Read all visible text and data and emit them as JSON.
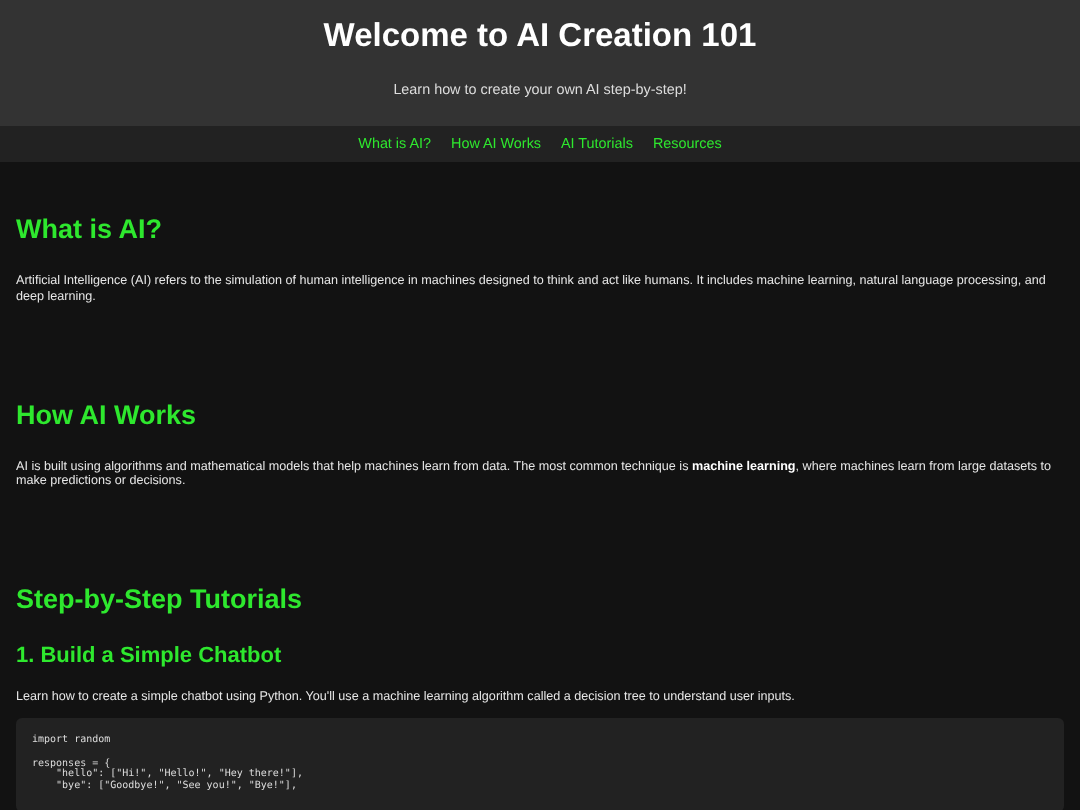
{
  "header": {
    "title": "Welcome to AI Creation 101",
    "subtitle": "Learn how to create your own AI step-by-step!"
  },
  "nav": [
    "What is AI?",
    "How AI Works",
    "AI Tutorials",
    "Resources"
  ],
  "sections": [
    {
      "heading": "What is AI?",
      "paragraph": "Artificial Intelligence (AI) refers to the simulation of human intelligence in machines designed to think and act like humans. It includes machine learning, natural language processing, and deep learning."
    },
    {
      "heading": "How AI Works",
      "paragraph": "AI is built using algorithms and mathematical models that help machines learn from data. The most common technique is **machine learning**, where machines learn from large datasets to make predictions or decisions."
    },
    {
      "heading": "Step-by-Step Tutorials",
      "tutorials": [
        {
          "title": "1. Build a Simple Chatbot",
          "paragraph": "Learn how to create a simple chatbot using Python. You'll use a machine learning algorithm called a decision tree to understand user inputs.",
          "code": "import random\n\nresponses = {\n    \"hello\": [\"Hi!\", \"Hello!\", \"Hey there!\"],\n    \"bye\": [\"Goodbye!\", \"See you!\", \"Bye!\"],"
        }
      ]
    }
  ]
}
